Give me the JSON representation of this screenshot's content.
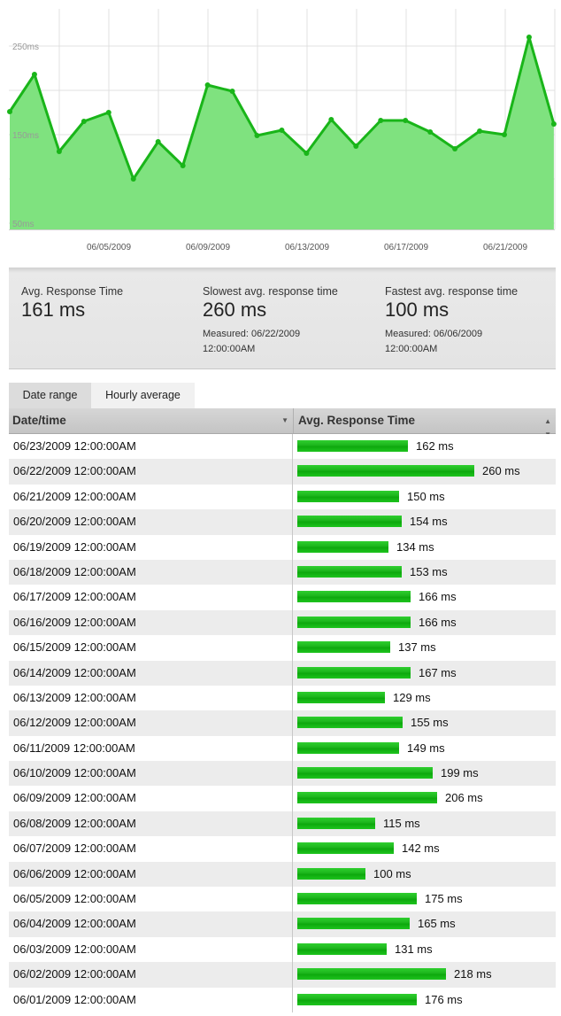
{
  "chart_data": {
    "type": "area",
    "title": "",
    "xlabel": "",
    "ylabel": "",
    "ylim": [
      40,
      290
    ],
    "yticks": [
      "50ms",
      "150ms",
      "250ms"
    ],
    "x_ticks": [
      "06/05/2009",
      "06/09/2009",
      "06/13/2009",
      "06/17/2009",
      "06/21/2009"
    ],
    "x": [
      "06/01/2009",
      "06/02/2009",
      "06/03/2009",
      "06/04/2009",
      "06/05/2009",
      "06/06/2009",
      "06/07/2009",
      "06/08/2009",
      "06/09/2009",
      "06/10/2009",
      "06/11/2009",
      "06/12/2009",
      "06/13/2009",
      "06/14/2009",
      "06/15/2009",
      "06/16/2009",
      "06/17/2009",
      "06/18/2009",
      "06/19/2009",
      "06/20/2009",
      "06/21/2009",
      "06/22/2009",
      "06/23/2009"
    ],
    "values": [
      176,
      218,
      131,
      165,
      175,
      100,
      142,
      115,
      206,
      199,
      149,
      155,
      129,
      167,
      137,
      166,
      166,
      153,
      134,
      154,
      150,
      260,
      162
    ],
    "series_color": "#19b519",
    "fill_color": "#7fe27f",
    "grid": true
  },
  "stats": {
    "avg_label": "Avg. Response Time",
    "avg_value": "161 ms",
    "slowest_label": "Slowest avg. response time",
    "slowest_value": "260 ms",
    "slowest_measured_1": "Measured: 06/22/2009",
    "slowest_measured_2": "12:00:00AM",
    "fastest_label": "Fastest avg. response time",
    "fastest_value": "100 ms",
    "fastest_measured_1": "Measured: 06/06/2009",
    "fastest_measured_2": "12:00:00AM"
  },
  "tabs": {
    "date_range": "Date range",
    "hourly_average": "Hourly average"
  },
  "table": {
    "col_date": "Date/time",
    "col_response": "Avg. Response Time",
    "sort_down_icon": "sort-descending-icon",
    "sort_both_icon": "sort-both-icon",
    "bar_color": "#19b519",
    "rows": [
      {
        "date": "06/23/2009 12:00:00AM",
        "value": 162,
        "label": "162 ms"
      },
      {
        "date": "06/22/2009 12:00:00AM",
        "value": 260,
        "label": "260 ms"
      },
      {
        "date": "06/21/2009 12:00:00AM",
        "value": 150,
        "label": "150 ms"
      },
      {
        "date": "06/20/2009 12:00:00AM",
        "value": 154,
        "label": "154 ms"
      },
      {
        "date": "06/19/2009 12:00:00AM",
        "value": 134,
        "label": "134 ms"
      },
      {
        "date": "06/18/2009 12:00:00AM",
        "value": 153,
        "label": "153 ms"
      },
      {
        "date": "06/17/2009 12:00:00AM",
        "value": 166,
        "label": "166 ms"
      },
      {
        "date": "06/16/2009 12:00:00AM",
        "value": 166,
        "label": "166 ms"
      },
      {
        "date": "06/15/2009 12:00:00AM",
        "value": 137,
        "label": "137 ms"
      },
      {
        "date": "06/14/2009 12:00:00AM",
        "value": 167,
        "label": "167 ms"
      },
      {
        "date": "06/13/2009 12:00:00AM",
        "value": 129,
        "label": "129 ms"
      },
      {
        "date": "06/12/2009 12:00:00AM",
        "value": 155,
        "label": "155 ms"
      },
      {
        "date": "06/11/2009 12:00:00AM",
        "value": 149,
        "label": "149 ms"
      },
      {
        "date": "06/10/2009 12:00:00AM",
        "value": 199,
        "label": "199 ms"
      },
      {
        "date": "06/09/2009 12:00:00AM",
        "value": 206,
        "label": "206 ms"
      },
      {
        "date": "06/08/2009 12:00:00AM",
        "value": 115,
        "label": "115 ms"
      },
      {
        "date": "06/07/2009 12:00:00AM",
        "value": 142,
        "label": "142 ms"
      },
      {
        "date": "06/06/2009 12:00:00AM",
        "value": 100,
        "label": "100 ms"
      },
      {
        "date": "06/05/2009 12:00:00AM",
        "value": 175,
        "label": "175 ms"
      },
      {
        "date": "06/04/2009 12:00:00AM",
        "value": 165,
        "label": "165 ms"
      },
      {
        "date": "06/03/2009 12:00:00AM",
        "value": 131,
        "label": "131 ms"
      },
      {
        "date": "06/02/2009 12:00:00AM",
        "value": 218,
        "label": "218 ms"
      },
      {
        "date": "06/01/2009 12:00:00AM",
        "value": 176,
        "label": "176 ms"
      }
    ]
  }
}
